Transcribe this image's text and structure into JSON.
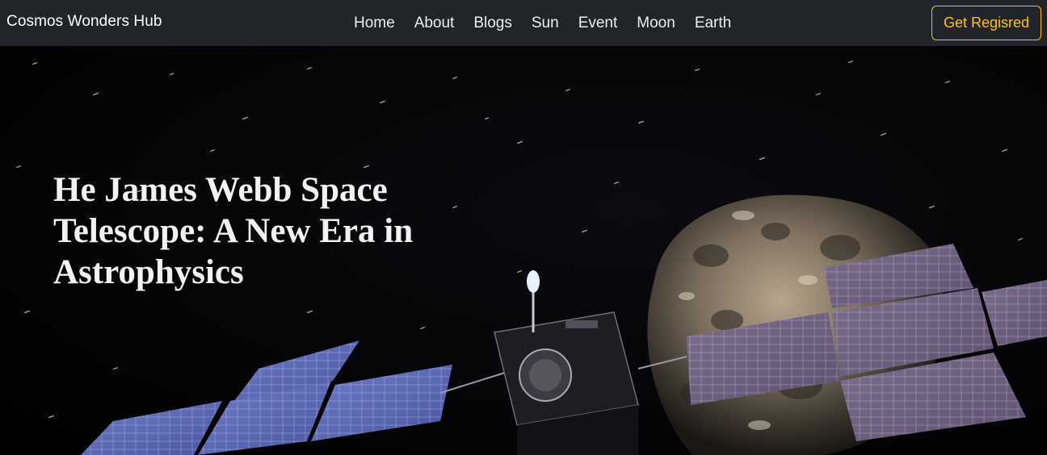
{
  "navbar": {
    "brand": "Cosmos Wonders Hub",
    "links": [
      {
        "label": "Home"
      },
      {
        "label": "About"
      },
      {
        "label": "Blogs"
      },
      {
        "label": "Sun"
      },
      {
        "label": "Event"
      },
      {
        "label": "Moon"
      },
      {
        "label": "Earth"
      }
    ],
    "cta_label": "Get Regisred"
  },
  "hero": {
    "title": "He James Webb Space Telescope: A New Era in Astrophysics",
    "image_subject": "spacecraft-approaching-asteroid"
  },
  "colors": {
    "navbar_bg": "#212529",
    "cta_accent": "#ffc107",
    "hero_bg": "#000000"
  }
}
